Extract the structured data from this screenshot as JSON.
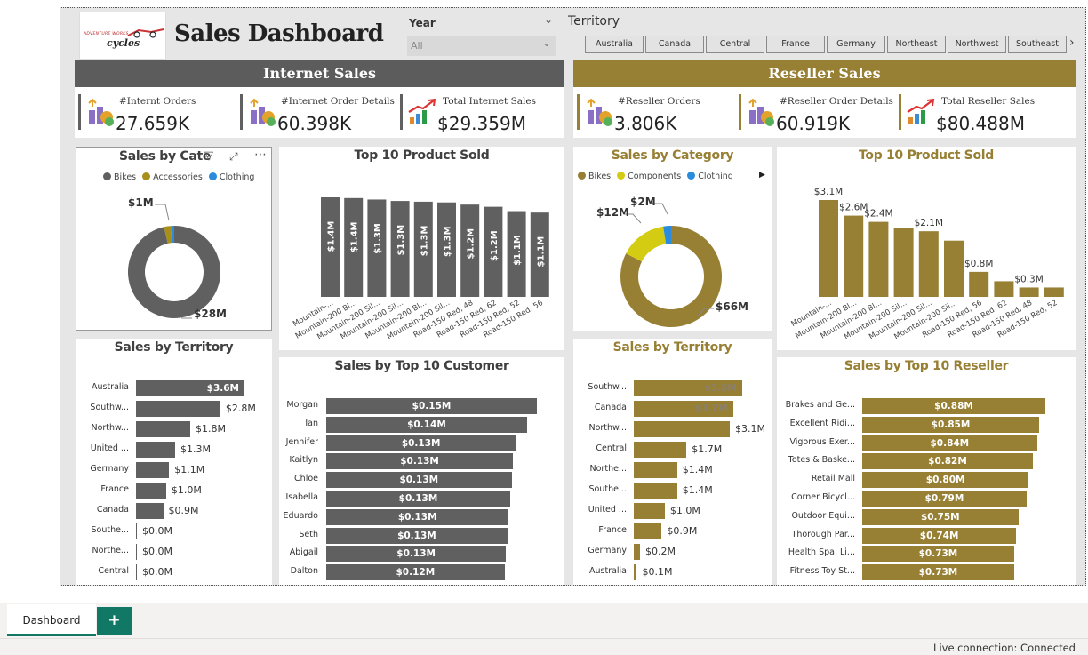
{
  "header": {
    "title": "Sales Dashboard",
    "logo_text": "cycles",
    "logo_subtext": "ADVENTURE WORKS"
  },
  "slicers": {
    "year_label": "Year",
    "year_value": "All",
    "territory_label": "Territory",
    "territories": [
      "Australia",
      "Canada",
      "Central",
      "France",
      "Germany",
      "Northeast",
      "Northwest",
      "Southeast"
    ]
  },
  "internet": {
    "band_title": "Internet Sales",
    "kpis": [
      {
        "label": "#Internt Orders",
        "value": "27.659K"
      },
      {
        "label": "#Internet Order Details",
        "value": "60.398K"
      },
      {
        "label": "Total Internet Sales",
        "value": "$29.359M"
      }
    ]
  },
  "reseller": {
    "band_title": "Reseller Sales",
    "kpis": [
      {
        "label": "#Reseller Orders",
        "value": "3.806K"
      },
      {
        "label": "#Reseller Order Details",
        "value": "60.919K"
      },
      {
        "label": "Total Reseller Sales",
        "value": "$80.488M"
      }
    ]
  },
  "colors": {
    "internet": "#606060",
    "reseller": "#977f33",
    "bikes_internet": "#606060",
    "accessories": "#a88f1c",
    "clothing": "#2b8cde",
    "components": "#d4cb13"
  },
  "chart_data": [
    {
      "id": "int_cat",
      "type": "pie",
      "title": "Sales by Cate",
      "categories": [
        "Bikes",
        "Accessories",
        "Clothing"
      ],
      "values": [
        28.3,
        0.7,
        0.34
      ],
      "data_labels": [
        "$28M",
        "$1M",
        ""
      ]
    },
    {
      "id": "int_prod",
      "type": "bar",
      "title": "Top 10 Product Sold",
      "categories": [
        "Mountain-...",
        "Mountain-200 Bl...",
        "Mountain-200 Sil...",
        "Mountain-200 Sil...",
        "Mountain-200 Bl...",
        "Mountain-200 Sil...",
        "Road-150 Red, 48",
        "Road-150 Red, 62",
        "Road-150 Red, 52",
        "Road-150 Red, 56"
      ],
      "values": [
        1.37,
        1.36,
        1.34,
        1.32,
        1.31,
        1.3,
        1.27,
        1.24,
        1.18,
        1.16
      ],
      "data_labels": [
        "$1.4M",
        "$1.4M",
        "$1.3M",
        "$1.3M",
        "$1.3M",
        "$1.3M",
        "$1.2M",
        "$1.2M",
        "$1.1M",
        "$1.1M"
      ]
    },
    {
      "id": "res_cat",
      "type": "pie",
      "title": "Sales by Category",
      "categories": [
        "Bikes",
        "Components",
        "Clothing"
      ],
      "values": [
        66,
        12,
        2
      ],
      "data_labels": [
        "$66M",
        "$12M",
        "$2M"
      ]
    },
    {
      "id": "res_prod",
      "type": "bar",
      "title": "Top 10 Product Sold",
      "categories": [
        "Mountain-...",
        "Mountain-200 Bl...",
        "Mountain-200 Bl...",
        "Mountain-200 Sil...",
        "Mountain-200 Sil...",
        "Mountain-200 Sil...",
        "Road-150 Red, 56",
        "Road-150 Red, 62",
        "Road-150 Red, 48",
        "Road-150 Red, 52"
      ],
      "values": [
        3.1,
        2.6,
        2.4,
        2.2,
        2.1,
        1.8,
        0.8,
        0.5,
        0.3,
        0.3
      ],
      "data_labels": [
        "$3.1M",
        "$2.6M",
        "$2.4M",
        "",
        "$2.1M",
        "",
        "$0.8M",
        "",
        "$0.3M",
        ""
      ]
    },
    {
      "id": "int_terr",
      "type": "bar",
      "orientation": "horizontal",
      "title": "Sales by Territory",
      "categories": [
        "Australia",
        "Southw...",
        "Northw...",
        "United ...",
        "Germany",
        "France",
        "Canada",
        "Southe...",
        "Northe...",
        "Central"
      ],
      "values": [
        3.6,
        2.8,
        1.8,
        1.3,
        1.1,
        1.0,
        0.9,
        0.0,
        0.0,
        0.0
      ],
      "data_labels": [
        "$3.6M",
        "$2.8M",
        "$1.8M",
        "$1.3M",
        "$1.1M",
        "$1.0M",
        "$0.9M",
        "$0.0M",
        "$0.0M",
        "$0.0M"
      ]
    },
    {
      "id": "int_cust",
      "type": "bar",
      "orientation": "horizontal",
      "title": "Sales by Top 10 Customer",
      "categories": [
        "Morgan",
        "Ian",
        "Jennifer",
        "Kaitlyn",
        "Chloe",
        "Isabella",
        "Eduardo",
        "Seth",
        "Abigail",
        "Dalton"
      ],
      "values": [
        0.15,
        0.143,
        0.135,
        0.133,
        0.132,
        0.131,
        0.13,
        0.129,
        0.128,
        0.127
      ],
      "data_labels": [
        "$0.15M",
        "$0.14M",
        "$0.13M",
        "$0.13M",
        "$0.13M",
        "$0.13M",
        "$0.13M",
        "$0.13M",
        "$0.13M",
        "$0.12M"
      ]
    },
    {
      "id": "res_terr",
      "type": "bar",
      "orientation": "horizontal",
      "title": "Sales by Territory",
      "categories": [
        "Southw...",
        "Canada",
        "Northw...",
        "Central",
        "Northe...",
        "Southe...",
        "United ...",
        "France",
        "Germany",
        "Australia"
      ],
      "values": [
        3.5,
        3.2,
        3.1,
        1.7,
        1.4,
        1.4,
        1.0,
        0.9,
        0.2,
        0.1
      ],
      "data_labels": [
        "$3.5M",
        "$3.2M",
        "$3.1M",
        "$1.7M",
        "$1.4M",
        "$1.4M",
        "$1.0M",
        "$0.9M",
        "$0.2M",
        "$0.1M"
      ]
    },
    {
      "id": "res_reseller",
      "type": "bar",
      "orientation": "horizontal",
      "title": "Sales by Top 10 Reseller",
      "categories": [
        "Brakes and Ge...",
        "Excellent Ridi...",
        "Vigorous Exer...",
        "Totes & Baske...",
        "Retail Mall",
        "Corner Bicycl...",
        "Outdoor Equi...",
        "Thorough Par...",
        "Health Spa, Li...",
        "Fitness Toy St..."
      ],
      "values": [
        0.88,
        0.85,
        0.84,
        0.82,
        0.8,
        0.79,
        0.75,
        0.74,
        0.73,
        0.73
      ],
      "data_labels": [
        "$0.88M",
        "$0.85M",
        "$0.84M",
        "$0.82M",
        "$0.80M",
        "$0.79M",
        "$0.75M",
        "$0.74M",
        "$0.73M",
        "$0.73M"
      ]
    }
  ],
  "tabs": {
    "active": "Dashboard",
    "add_label": "+"
  },
  "status": {
    "text": "Live connection: Connected"
  }
}
